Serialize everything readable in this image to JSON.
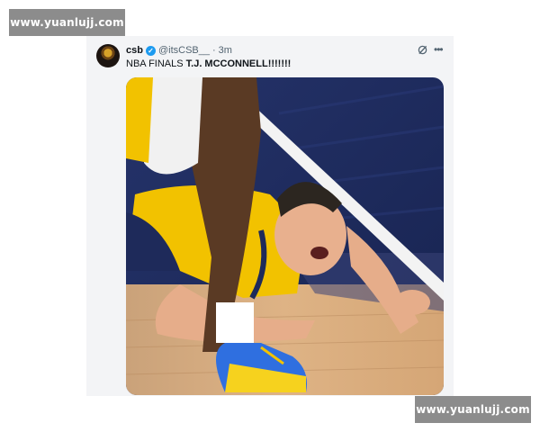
{
  "watermarks": {
    "top": "www.yuanlujj.com",
    "bottom": "www.yuanlujj.com"
  },
  "tweet": {
    "author": "csb",
    "handle": "@itsCSB__",
    "separator": "·",
    "time": "3m",
    "text_prefix": "NBA FINALS ",
    "text_bold": "T.J. MCCONNELL!!!!!!!",
    "verified_icon": "verified-badge-icon",
    "grok_icon": "grok-icon",
    "more_icon": "more-horizontal-icon"
  },
  "media": {
    "description_icon": "photo",
    "colors": {
      "court": "#d9a774",
      "floor_blue": "#1e2d5c",
      "jersey": "#f2c200",
      "shoe_blue": "#2f6fe0"
    }
  }
}
